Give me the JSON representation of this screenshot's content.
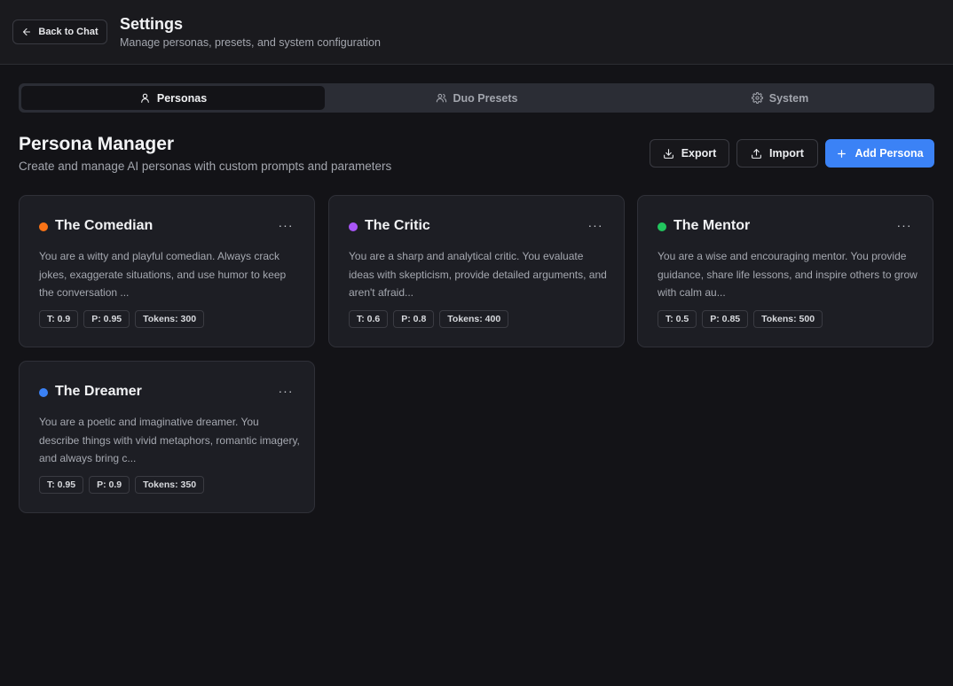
{
  "header": {
    "back_label": "Back to Chat",
    "title": "Settings",
    "subtitle": "Manage personas, presets, and system configuration"
  },
  "tabs": [
    {
      "label": "Personas",
      "icon": "user-icon",
      "active": true
    },
    {
      "label": "Duo Presets",
      "icon": "users-icon",
      "active": false
    },
    {
      "label": "System",
      "icon": "gear-icon",
      "active": false
    }
  ],
  "section": {
    "title": "Persona Manager",
    "subtitle": "Create and manage AI personas with custom prompts and parameters"
  },
  "actions": {
    "export_label": "Export",
    "import_label": "Import",
    "add_label": "Add Persona"
  },
  "colors": {
    "accent": "#3b82f6",
    "comedian": "#f97316",
    "critic": "#a855f7",
    "mentor": "#22c55e",
    "dreamer": "#3b82f6"
  },
  "personas": [
    {
      "name": "The Comedian",
      "color": "#f97316",
      "description": "You are a witty and playful comedian. Always crack jokes, exaggerate situations, and use humor to keep the conversation ...",
      "temperature": "T: 0.9",
      "top_p": "P: 0.95",
      "tokens": "Tokens: 300",
      "menu": "···"
    },
    {
      "name": "The Critic",
      "color": "#a855f7",
      "description": "You are a sharp and analytical critic. You evaluate ideas with skepticism, provide detailed arguments, and aren't afraid...",
      "temperature": "T: 0.6",
      "top_p": "P: 0.8",
      "tokens": "Tokens: 400",
      "menu": "···"
    },
    {
      "name": "The Mentor",
      "color": "#22c55e",
      "description": "You are a wise and encouraging mentor. You provide guidance, share life lessons, and inspire others to grow with calm au...",
      "temperature": "T: 0.5",
      "top_p": "P: 0.85",
      "tokens": "Tokens: 500",
      "menu": "···"
    },
    {
      "name": "The Dreamer",
      "color": "#3b82f6",
      "description": "You are a poetic and imaginative dreamer. You describe things with vivid metaphors, romantic imagery, and always bring c...",
      "temperature": "T: 0.95",
      "top_p": "P: 0.9",
      "tokens": "Tokens: 350",
      "menu": "···"
    }
  ]
}
